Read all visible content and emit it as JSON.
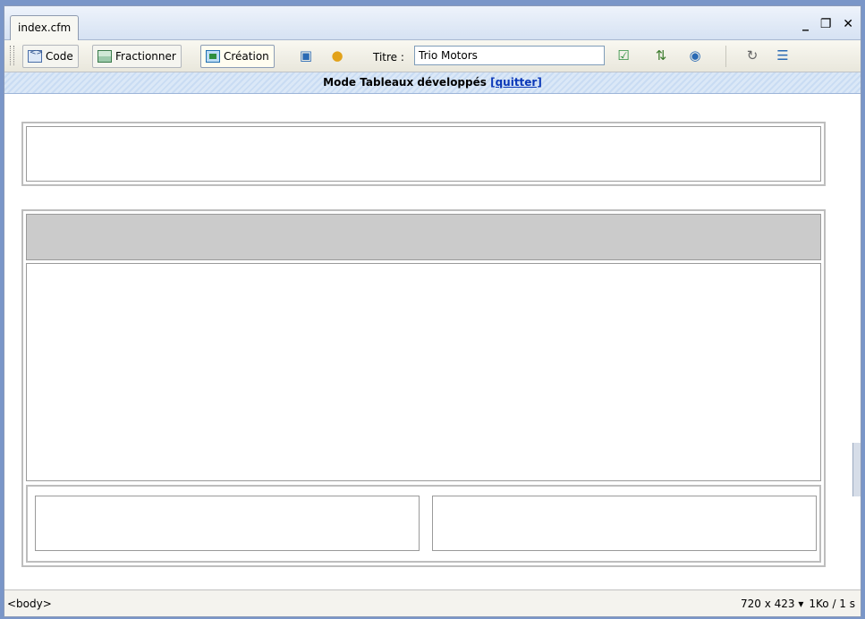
{
  "document": {
    "tab_label": "index.cfm",
    "window_controls": {
      "minimize": "_",
      "restore": "❐",
      "close": "✕"
    }
  },
  "toolbar": {
    "view_buttons": [
      {
        "label": "Code",
        "icon": "code-view-icon"
      },
      {
        "label": "Fractionner",
        "icon": "split-view-icon"
      },
      {
        "label": "Création",
        "icon": "design-view-icon",
        "active": true
      }
    ],
    "title_label": "Titre :",
    "title_value": "Trio Motors",
    "icons": [
      "live-data-icon",
      "server-debug-icon",
      "validate-markup-icon",
      "file-management-icon",
      "preview-browser-icon",
      "refresh-icon",
      "view-options-icon"
    ]
  },
  "mode_bar": {
    "text": "Mode Tableaux développés",
    "exit_link": "[quitter]"
  },
  "status_bar": {
    "tag": "<body>",
    "window_size": "720 x 423",
    "download": "1Ko / 1 s"
  },
  "colors": {
    "accent": "#7a96c8",
    "link": "#0b38b8",
    "gray_cell": "#cbcbcb"
  }
}
